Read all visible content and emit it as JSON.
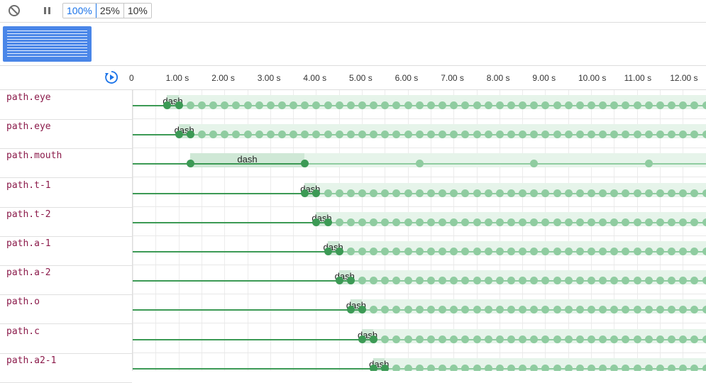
{
  "toolbar": {
    "clear_icon": "block-icon",
    "pause_icon": "pause-icon",
    "rates": [
      {
        "label": "100%",
        "selected": true
      },
      {
        "label": "25%",
        "selected": false
      },
      {
        "label": "10%",
        "selected": false
      }
    ]
  },
  "timeline": {
    "replay_icon": "replay-icon",
    "ticks": [
      "0",
      "1.00 s",
      "2.00 s",
      "3.00 s",
      "4.00 s",
      "5.00 s",
      "6.00 s",
      "7.00 s",
      "8.00 s",
      "9.00 s",
      "10.00 s",
      "11.00 s",
      "12.00 s"
    ]
  },
  "animations": [
    {
      "name": "path.eye",
      "label": "dash",
      "delay_s": 0.75,
      "duration_s": 0.25,
      "iteration_s": 0.25
    },
    {
      "name": "path.eye",
      "label": "dash",
      "delay_s": 1.0,
      "duration_s": 0.25,
      "iteration_s": 0.25
    },
    {
      "name": "path.mouth",
      "label": "dash",
      "delay_s": 1.25,
      "duration_s": 2.5,
      "iteration_s": 2.5
    },
    {
      "name": "path.t-1",
      "label": "dash",
      "delay_s": 3.75,
      "duration_s": 0.25,
      "iteration_s": 0.25
    },
    {
      "name": "path.t-2",
      "label": "dash",
      "delay_s": 4.0,
      "duration_s": 0.25,
      "iteration_s": 0.25
    },
    {
      "name": "path.a-1",
      "label": "dash",
      "delay_s": 4.25,
      "duration_s": 0.25,
      "iteration_s": 0.25
    },
    {
      "name": "path.a-2",
      "label": "dash",
      "delay_s": 4.5,
      "duration_s": 0.25,
      "iteration_s": 0.25
    },
    {
      "name": "path.o",
      "label": "dash",
      "delay_s": 4.75,
      "duration_s": 0.25,
      "iteration_s": 0.25
    },
    {
      "name": "path.c",
      "label": "dash",
      "delay_s": 5.0,
      "duration_s": 0.25,
      "iteration_s": 0.25
    },
    {
      "name": "path.a2-1",
      "label": "dash",
      "delay_s": 5.25,
      "duration_s": 0.25,
      "iteration_s": 0.25
    }
  ],
  "colors": {
    "accent": "#1a73e8",
    "preview": "#4a86e8",
    "line_active": "#3c9a55",
    "line_iter": "#8fcca0",
    "band": "#e6f4ea",
    "band_active": "#cfe8d6",
    "name_text": "#8b1a4a"
  }
}
